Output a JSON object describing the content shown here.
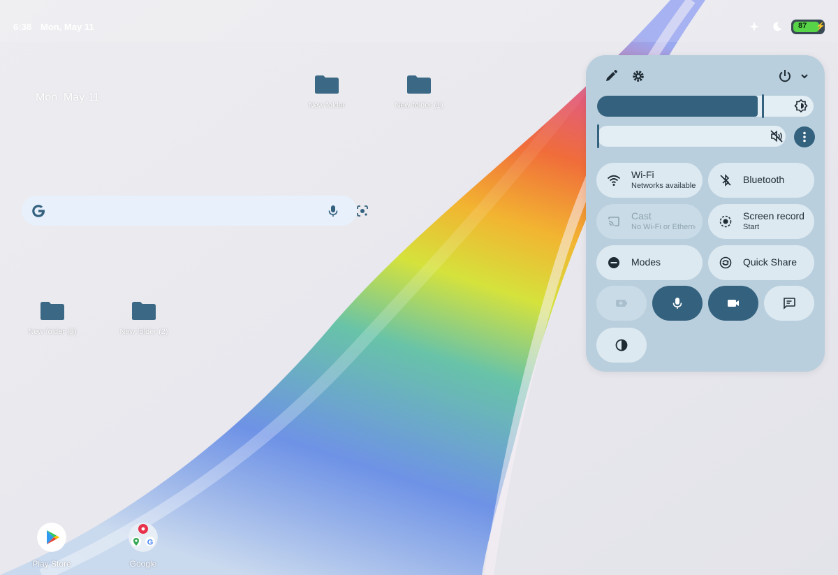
{
  "status_bar": {
    "time": "6:38",
    "date": "Mon, May 11",
    "battery_level": 87,
    "battery_label": "87",
    "icons": [
      "sparkle-icon",
      "night-mode-icon",
      "battery-icon"
    ]
  },
  "desktop": {
    "date_widget": "Mon, May 11",
    "folders": [
      {
        "label": "New folder"
      },
      {
        "label": "New folder (1)"
      },
      {
        "label": "New folder (3)"
      },
      {
        "label": "New folder (2)"
      }
    ],
    "search": {
      "placeholder": "",
      "icons": [
        "google-g-icon",
        "mic-icon",
        "lens-icon"
      ]
    },
    "apps": [
      {
        "label": "Play Store",
        "icon": "play-store-icon"
      },
      {
        "label": "Google",
        "icon": "google-folder-icon"
      }
    ]
  },
  "quick_settings": {
    "toolbar_icons": [
      "edit-icon",
      "settings-icon",
      "power-icon",
      "chevron-down-icon"
    ],
    "brightness_level": 0.76,
    "volume_level": 0.0,
    "tiles": {
      "wifi": {
        "title": "Wi-Fi",
        "subtitle": "Networks available"
      },
      "bluetooth": {
        "title": "Bluetooth"
      },
      "cast": {
        "title": "Cast",
        "subtitle": "No Wi-Fi or Ethernet"
      },
      "screen_record": {
        "title": "Screen record",
        "subtitle": "Start"
      },
      "modes": {
        "title": "Modes"
      },
      "quick_share": {
        "title": "Quick Share"
      }
    },
    "small_tiles": [
      "battery-saver-icon",
      "mic-icon",
      "camera-icon",
      "feedback-icon",
      "contrast-icon"
    ]
  },
  "colors": {
    "accent": "#34617e",
    "panel_background": "#b9cfdd",
    "tile_background": "#dde9f1",
    "battery_green": "#57d448"
  }
}
